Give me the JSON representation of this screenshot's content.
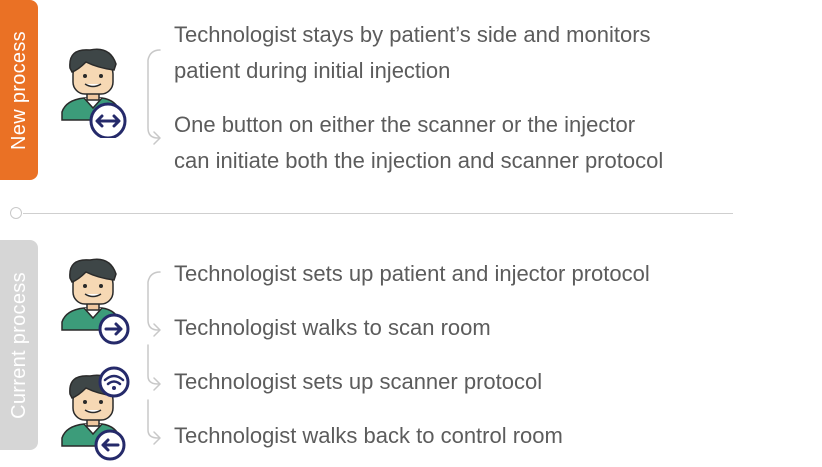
{
  "new_process": {
    "label": "New process",
    "steps": [
      {
        "text_line1": "Technologist stays by patient’s side and monitors",
        "text_line2": "patient during initial injection"
      },
      {
        "text_line1": "One button on either the scanner or the injector",
        "text_line2": "can initiate both the injection and scanner protocol"
      }
    ]
  },
  "current_process": {
    "label": "Current process",
    "steps": [
      "Technologist sets up patient and injector protocol",
      "Technologist walks to scan room",
      "Technologist sets up scanner protocol",
      "Technologist walks back to control room"
    ]
  },
  "icons": {
    "avatar_1": "technologist-avatar-icon",
    "badge_1": "two-way-arrow-icon",
    "avatar_2": "technologist-avatar-icon",
    "badge_2": "right-arrow-icon",
    "avatar_3": "technologist-avatar-icon",
    "badge_3": "wifi-icon",
    "badge_4": "left-arrow-icon"
  },
  "colors": {
    "new_tab": "#ea7125",
    "current_tab": "#d6d6d6",
    "text": "#5c5c5c",
    "badge": "#252a6a",
    "hair": "#3e4647",
    "skin": "#f6d8b4",
    "shirt": "#3c9c7a"
  }
}
